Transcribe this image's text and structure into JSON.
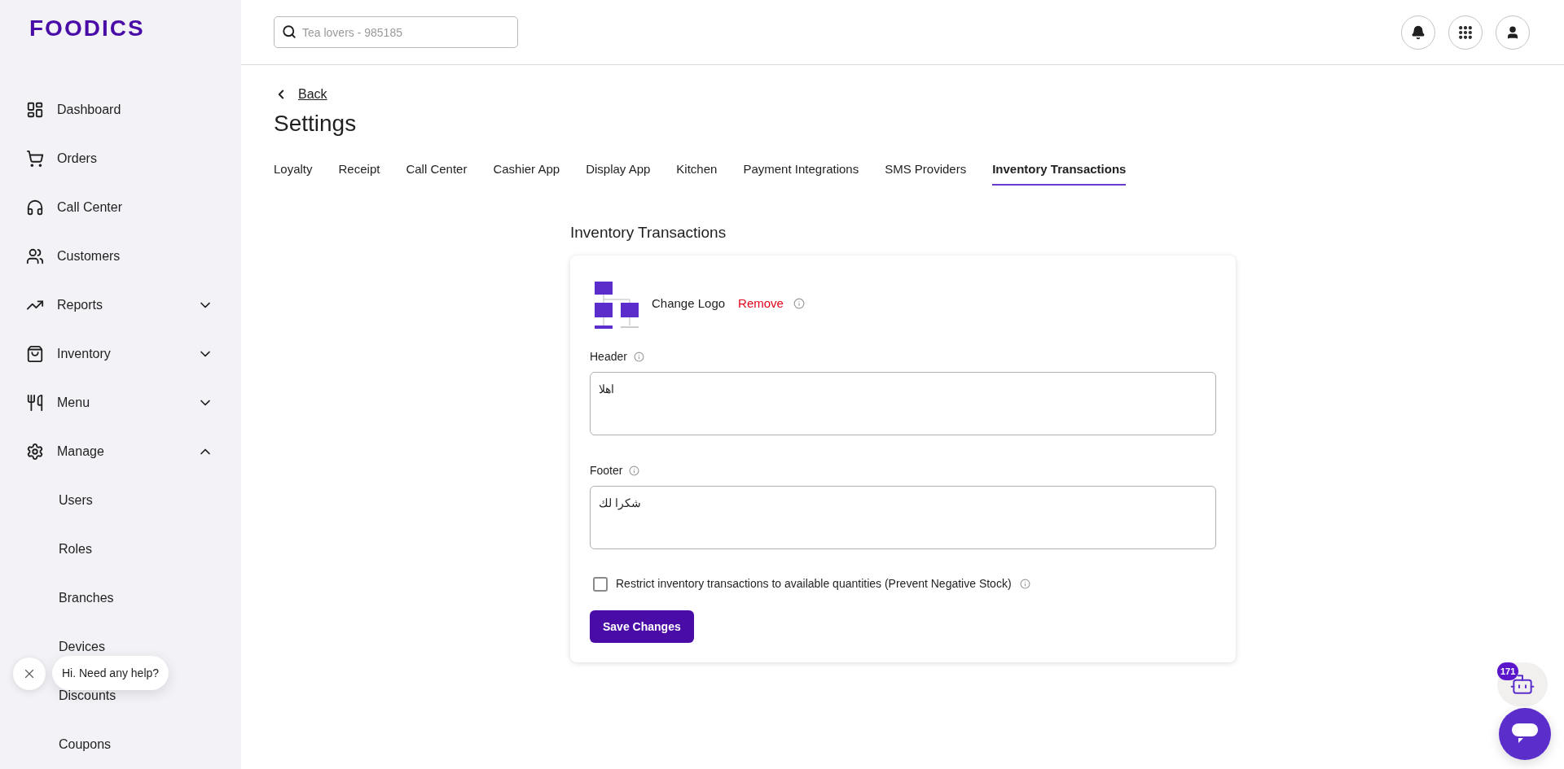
{
  "brand": "FOODICS",
  "sidebar": {
    "items": [
      {
        "label": "Dashboard"
      },
      {
        "label": "Orders"
      },
      {
        "label": "Call Center"
      },
      {
        "label": "Customers"
      },
      {
        "label": "Reports",
        "expanded": false
      },
      {
        "label": "Inventory",
        "expanded": false
      },
      {
        "label": "Menu",
        "expanded": false
      },
      {
        "label": "Manage",
        "expanded": true,
        "children": [
          {
            "label": "Users"
          },
          {
            "label": "Roles"
          },
          {
            "label": "Branches"
          },
          {
            "label": "Devices"
          },
          {
            "label": "Discounts"
          },
          {
            "label": "Coupons"
          }
        ]
      }
    ]
  },
  "search": {
    "placeholder": "Tea lovers - 985185"
  },
  "back": "Back",
  "title": "Settings",
  "tabs": [
    {
      "label": "Loyalty",
      "selected": false
    },
    {
      "label": "Receipt",
      "selected": false
    },
    {
      "label": "Call Center",
      "selected": false
    },
    {
      "label": "Cashier App",
      "selected": false
    },
    {
      "label": "Display App",
      "selected": false
    },
    {
      "label": "Kitchen",
      "selected": false
    },
    {
      "label": "Payment Integrations",
      "selected": false
    },
    {
      "label": "SMS Providers",
      "selected": false
    },
    {
      "label": "Inventory Transactions",
      "selected": true
    }
  ],
  "section_title": "Inventory Transactions",
  "card": {
    "change_logo": "Change Logo",
    "remove": "Remove",
    "header": {
      "label": "Header",
      "value": "اهلا"
    },
    "footer": {
      "label": "Footer",
      "value": "شكرا لك"
    },
    "restrict": {
      "label": "Restrict inventory transactions to available quantities (Prevent Negative Stock)",
      "checked": false
    },
    "save": "Save Changes"
  },
  "help_bubble": "Hi. Need any help?",
  "chat_badge": "171"
}
